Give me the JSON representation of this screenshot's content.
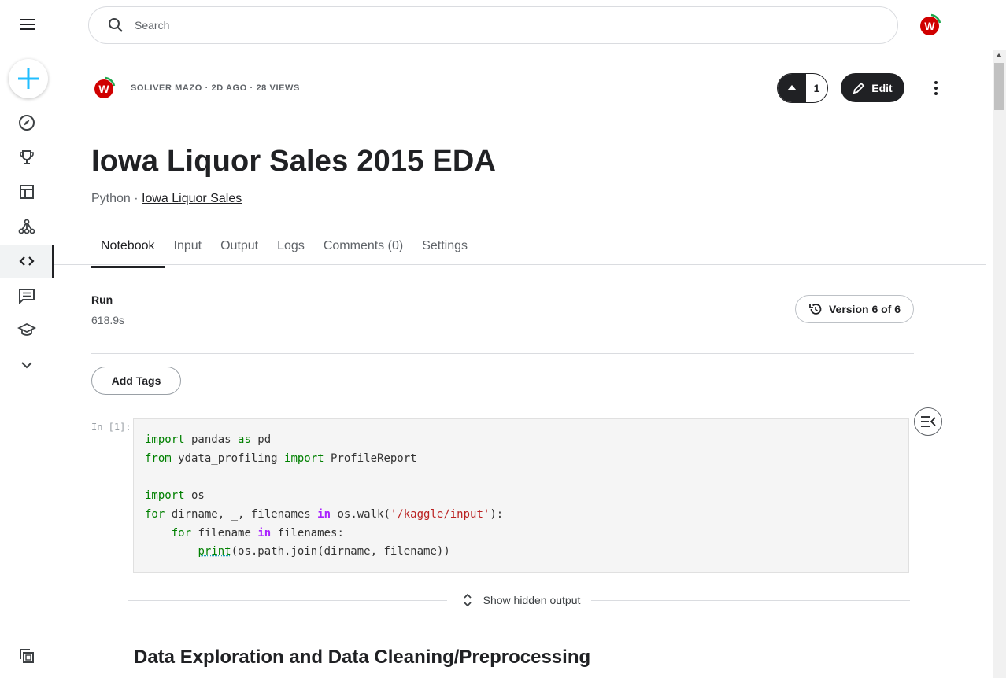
{
  "search": {
    "placeholder": "Search"
  },
  "nav": {
    "items": [
      "menu-icon",
      "create-icon",
      "compass-icon",
      "trophy-icon",
      "table-icon",
      "models-icon",
      "code-icon",
      "discussion-icon",
      "school-icon",
      "chevron-down-icon",
      "copy-icon"
    ],
    "active": "code"
  },
  "header": {
    "meta": "SOLIVER MAZO · 2D AGO · 28 VIEWS",
    "vote_count": "1",
    "edit_label": "Edit"
  },
  "notebook": {
    "title": "Iowa Liquor Sales 2015 EDA",
    "language": "Python",
    "separator": " · ",
    "dataset": "Iowa Liquor Sales"
  },
  "tabs": [
    {
      "label": "Notebook"
    },
    {
      "label": "Input"
    },
    {
      "label": "Output"
    },
    {
      "label": "Logs"
    },
    {
      "label": "Comments (0)"
    },
    {
      "label": "Settings"
    }
  ],
  "run": {
    "label": "Run",
    "value": "618.9s"
  },
  "version": {
    "label": "Version 6 of 6"
  },
  "tags": {
    "label": "Add Tags"
  },
  "cell": {
    "prompt": "In [1]:"
  },
  "hidden_output": {
    "label": "Show hidden output"
  },
  "section": {
    "heading": "Data Exploration and Data Cleaning/Preprocessing"
  },
  "colors": {
    "accent": "#20beff",
    "dark": "#202124",
    "brand_red": "#d00000",
    "brand_green": "#1ca64c"
  }
}
